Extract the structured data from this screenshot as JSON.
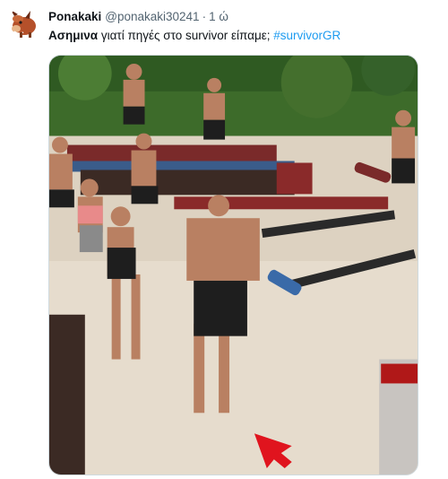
{
  "tweet": {
    "author": {
      "display_name": "Ponakaki",
      "handle": "@ponakaki30241",
      "separator": "·",
      "time": "1 ώ",
      "avatar_icon": "pumbaa-avatar-icon"
    },
    "text": {
      "bold_word": "Ασημινα",
      "body": " γιατί πηγές στο survivor  είπαμε; ",
      "hashtag": "#survivorGR"
    },
    "media": {
      "type": "photo",
      "icon": "red-arrow-icon"
    }
  },
  "colors": {
    "text_primary": "#0f1419",
    "text_secondary": "#536471",
    "hashtag": "#1d9bf0",
    "arrow": "#e0141e"
  }
}
